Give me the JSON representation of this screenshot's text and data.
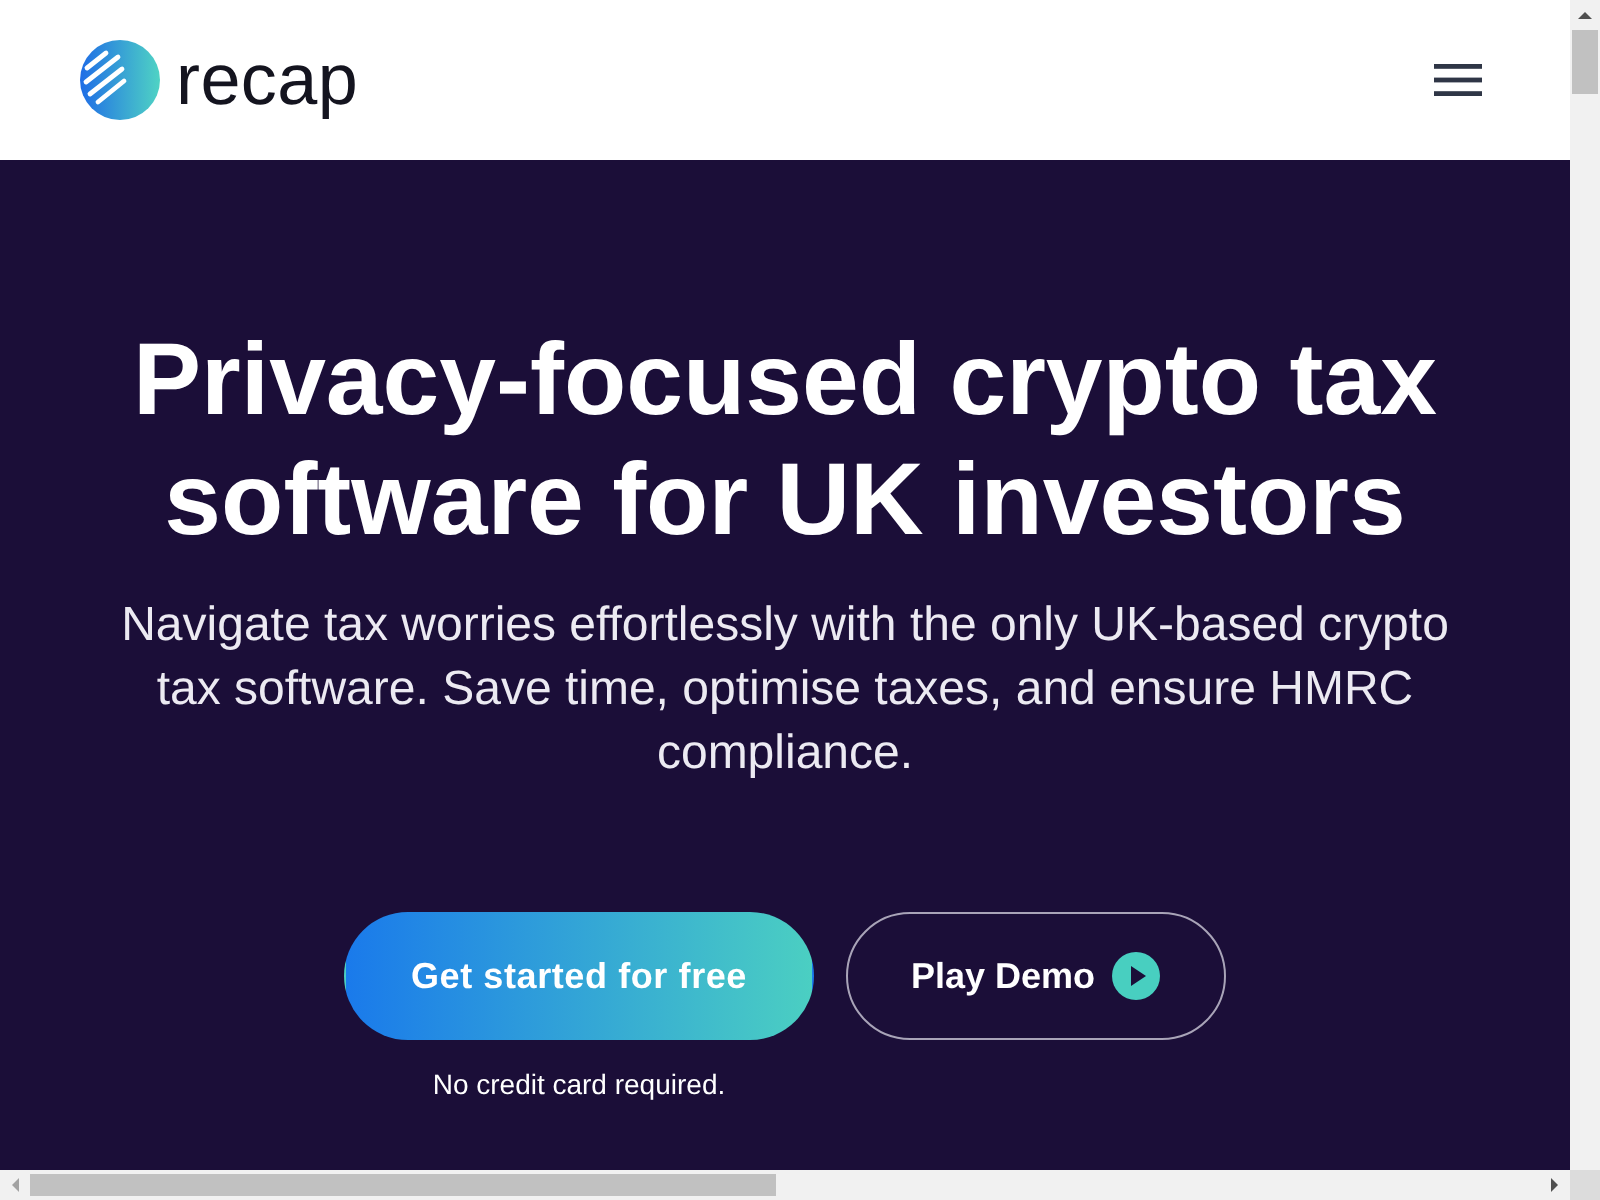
{
  "header": {
    "logo_text": "recap"
  },
  "hero": {
    "title": "Privacy-focused crypto tax software for UK investors",
    "subtitle": "Navigate tax worries effortlessly with the only UK-based crypto tax software. Save time, optimise taxes, and ensure HMRC compliance.",
    "buttons": [
      {
        "label": "Get started for free",
        "kind": "primary"
      },
      {
        "label": "Play Demo",
        "kind": "outline"
      }
    ],
    "note": "No credit card required."
  }
}
